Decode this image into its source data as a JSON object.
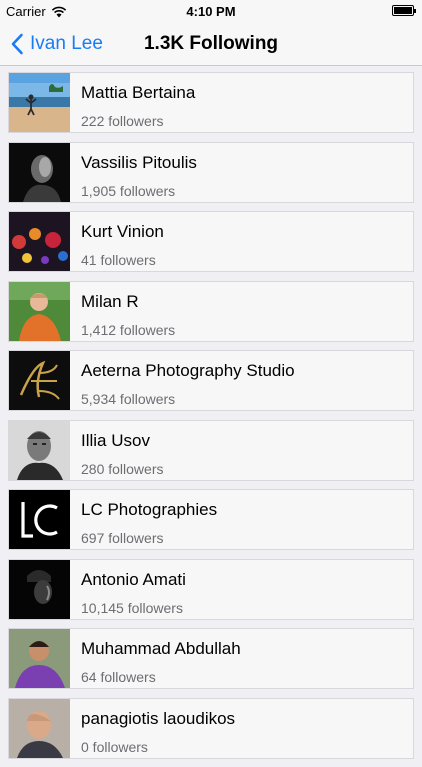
{
  "status_bar": {
    "carrier": "Carrier",
    "time": "4:10 PM"
  },
  "nav": {
    "back_label": "Ivan Lee",
    "title": "1.3K Following"
  },
  "users": [
    {
      "name": "Mattia Bertaina",
      "followers": "222 followers",
      "avatar": "beach-photo"
    },
    {
      "name": "Vassilis Pitoulis",
      "followers": "1,905 followers",
      "avatar": "dark-portrait"
    },
    {
      "name": "Kurt Vinion",
      "followers": "41 followers",
      "avatar": "bokeh-lights"
    },
    {
      "name": "Milan R",
      "followers": "1,412 followers",
      "avatar": "man-outdoors"
    },
    {
      "name": "Aeterna Photography Studio",
      "followers": "5,934 followers",
      "avatar": "gold-logo"
    },
    {
      "name": "Illia Usov",
      "followers": "280 followers",
      "avatar": "bw-portrait"
    },
    {
      "name": "LC Photographies",
      "followers": "697 followers",
      "avatar": "lc-logo"
    },
    {
      "name": "Antonio Amati",
      "followers": "10,145 followers",
      "avatar": "shadow-portrait"
    },
    {
      "name": "Muhammad Abdullah",
      "followers": "64 followers",
      "avatar": "young-man"
    },
    {
      "name": "panagiotis laoudikos",
      "followers": "0 followers",
      "avatar": "bald-man"
    }
  ]
}
